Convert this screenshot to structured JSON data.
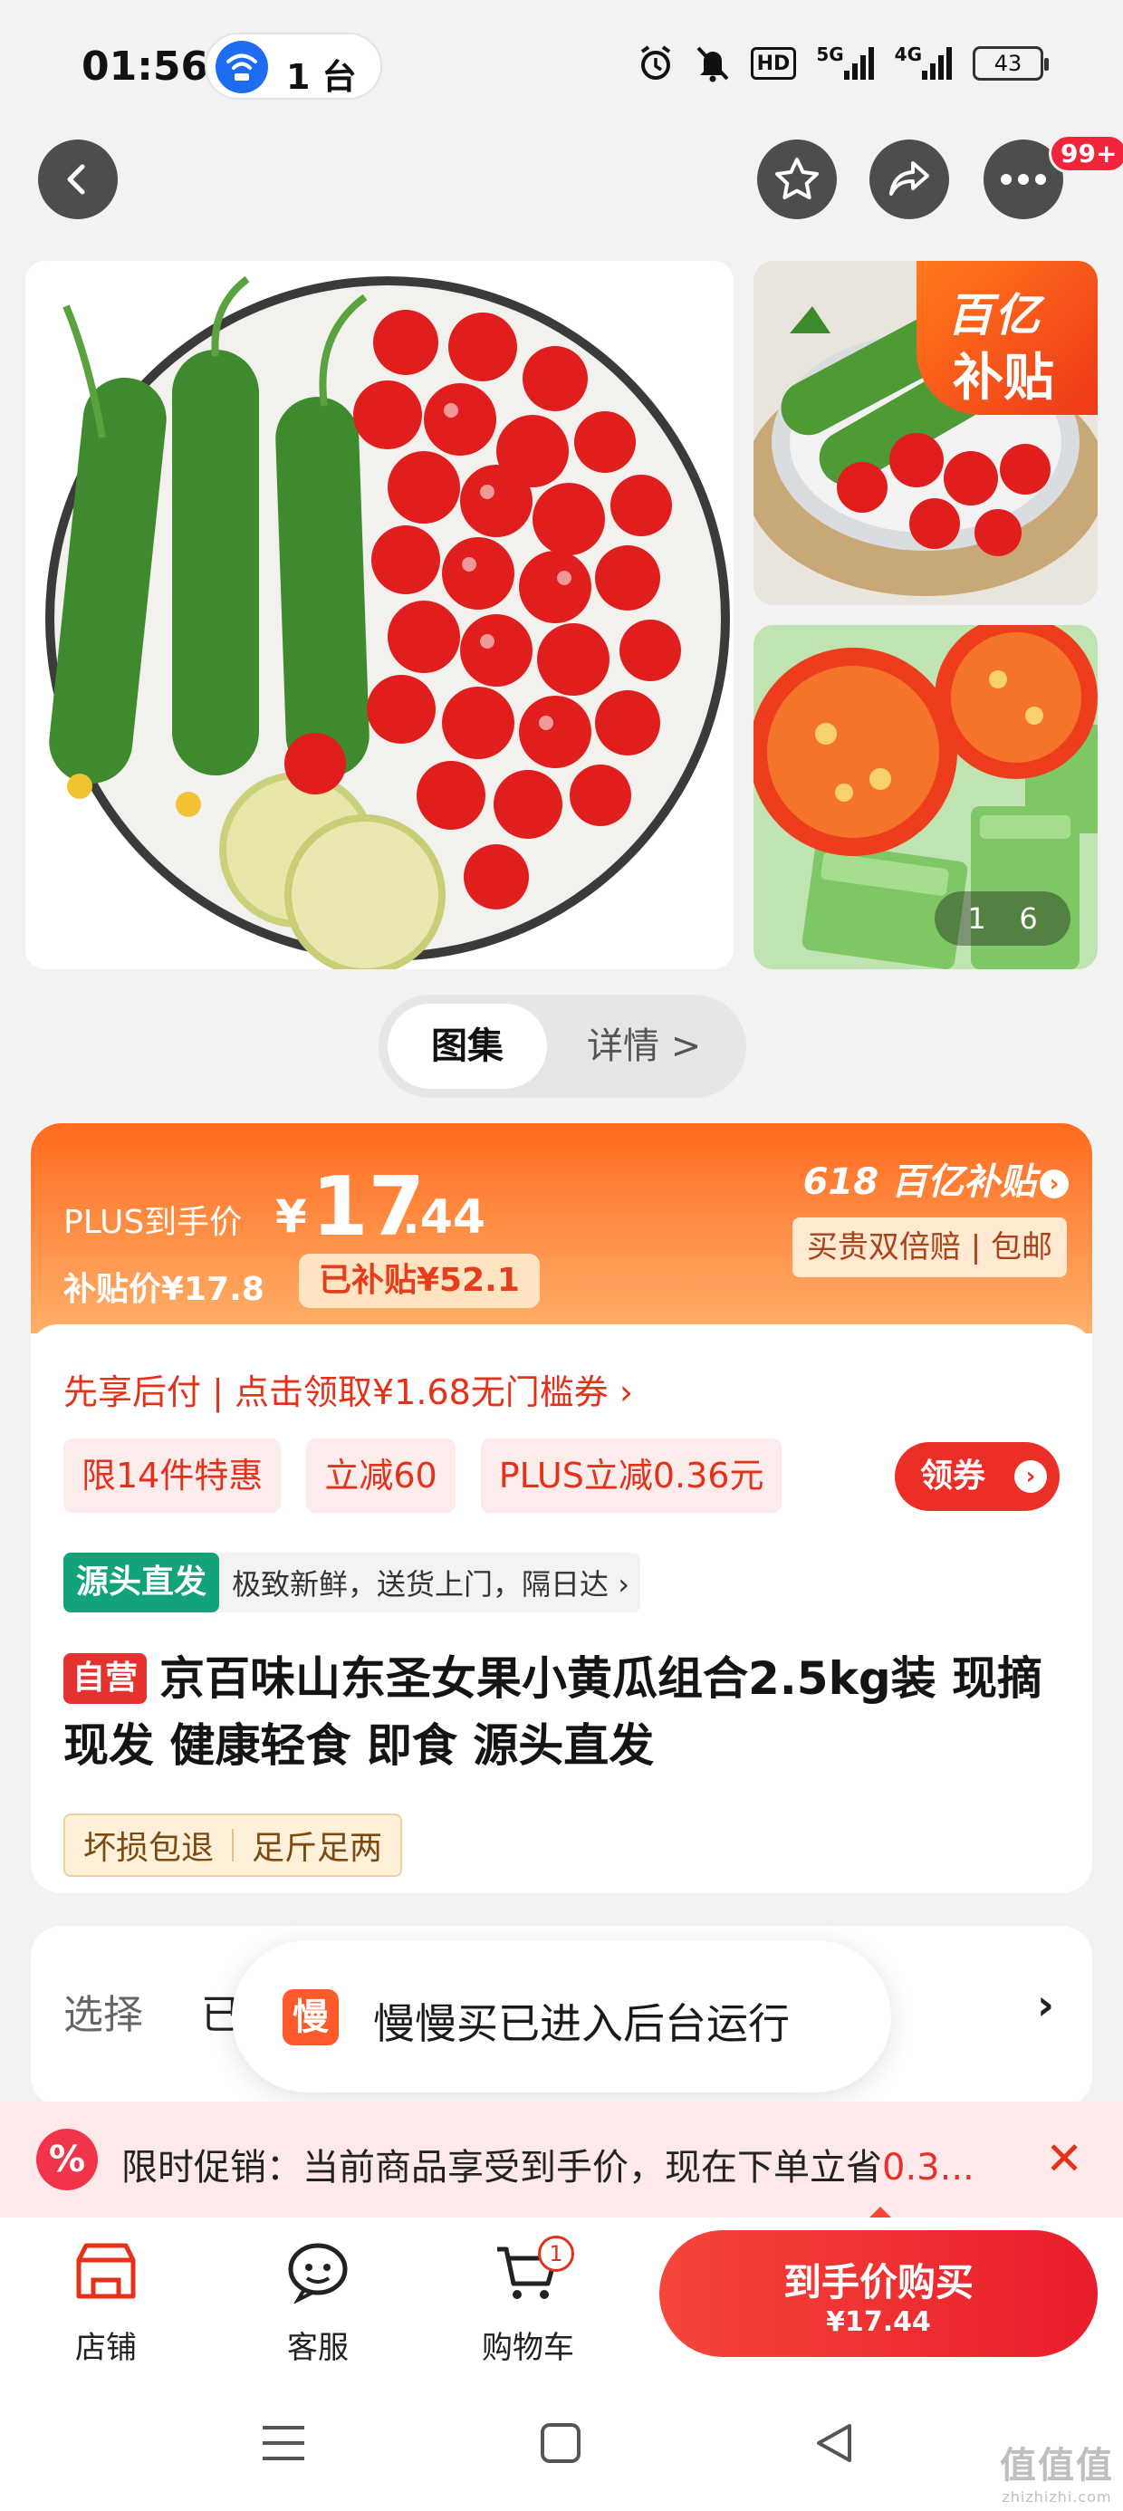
{
  "status_bar": {
    "time": "01:56",
    "hotspot_count": "1 台",
    "network_5g": "5G",
    "network_4g": "4G",
    "hd_label": "HD",
    "battery": "43"
  },
  "top_bar": {
    "back_icon": "chevron-left-icon",
    "favorite_icon": "star-icon",
    "share_icon": "share-icon",
    "more_icon": "more-dots-icon",
    "message_badge": "99+"
  },
  "gallery": {
    "subsidy_tag_line1": "百亿",
    "subsidy_tag_line2": "补贴",
    "pager_current": "1",
    "pager_total": "6"
  },
  "view_toggle": {
    "gallery_label": "图集",
    "details_label": "详情 >"
  },
  "price": {
    "plus_label": "PLUS到手价",
    "currency": "¥",
    "integer": "17",
    "decimal": ".44",
    "subsidy_price": "补贴价¥17.8",
    "subsidized_amount": "已补贴¥52.1",
    "promo_618": "618 百亿补贴",
    "guarantee_chip": "买贵双倍赔 | 包邮"
  },
  "offers": {
    "pay_later": "先享后付 | 点击领取¥1.68无门槛券 ›",
    "chips": [
      "限14件特惠",
      "立减60",
      "PLUS立减0.36元"
    ],
    "coupon_button": "领券"
  },
  "source": {
    "tag": "源头直发",
    "desc": "极致新鲜，送货上门，隔日达 ›"
  },
  "product": {
    "self_tag": "自营",
    "title": "京百味山东圣女果小黄瓜组合2.5kg装 现摘现发 健康轻食 即食 源头直发",
    "guarantees": [
      "坏损包退",
      "足斤足两"
    ]
  },
  "select_row": {
    "label": "选择",
    "value": "已"
  },
  "toast": {
    "icon_text": "慢",
    "text": "慢慢买已进入后台运行"
  },
  "promo_strip": {
    "icon_text": "%",
    "text": "限时促销：当前商品享受到手价，现在下单立省",
    "highlight": "0.3..."
  },
  "bottom_nav": {
    "items": [
      {
        "label": "店铺",
        "icon": "store-icon"
      },
      {
        "label": "客服",
        "icon": "customer-service-icon"
      },
      {
        "label": "购物车",
        "icon": "cart-icon"
      }
    ],
    "cart_badge": "1",
    "buy_label": "到手价购买",
    "buy_price": "¥17.44"
  },
  "watermark": {
    "text": "值值值",
    "sub": "zhizhizhi.com"
  },
  "colors": {
    "accent_orange": "#ff6b1f",
    "accent_red": "#ec2f26",
    "source_green": "#13a37a"
  }
}
